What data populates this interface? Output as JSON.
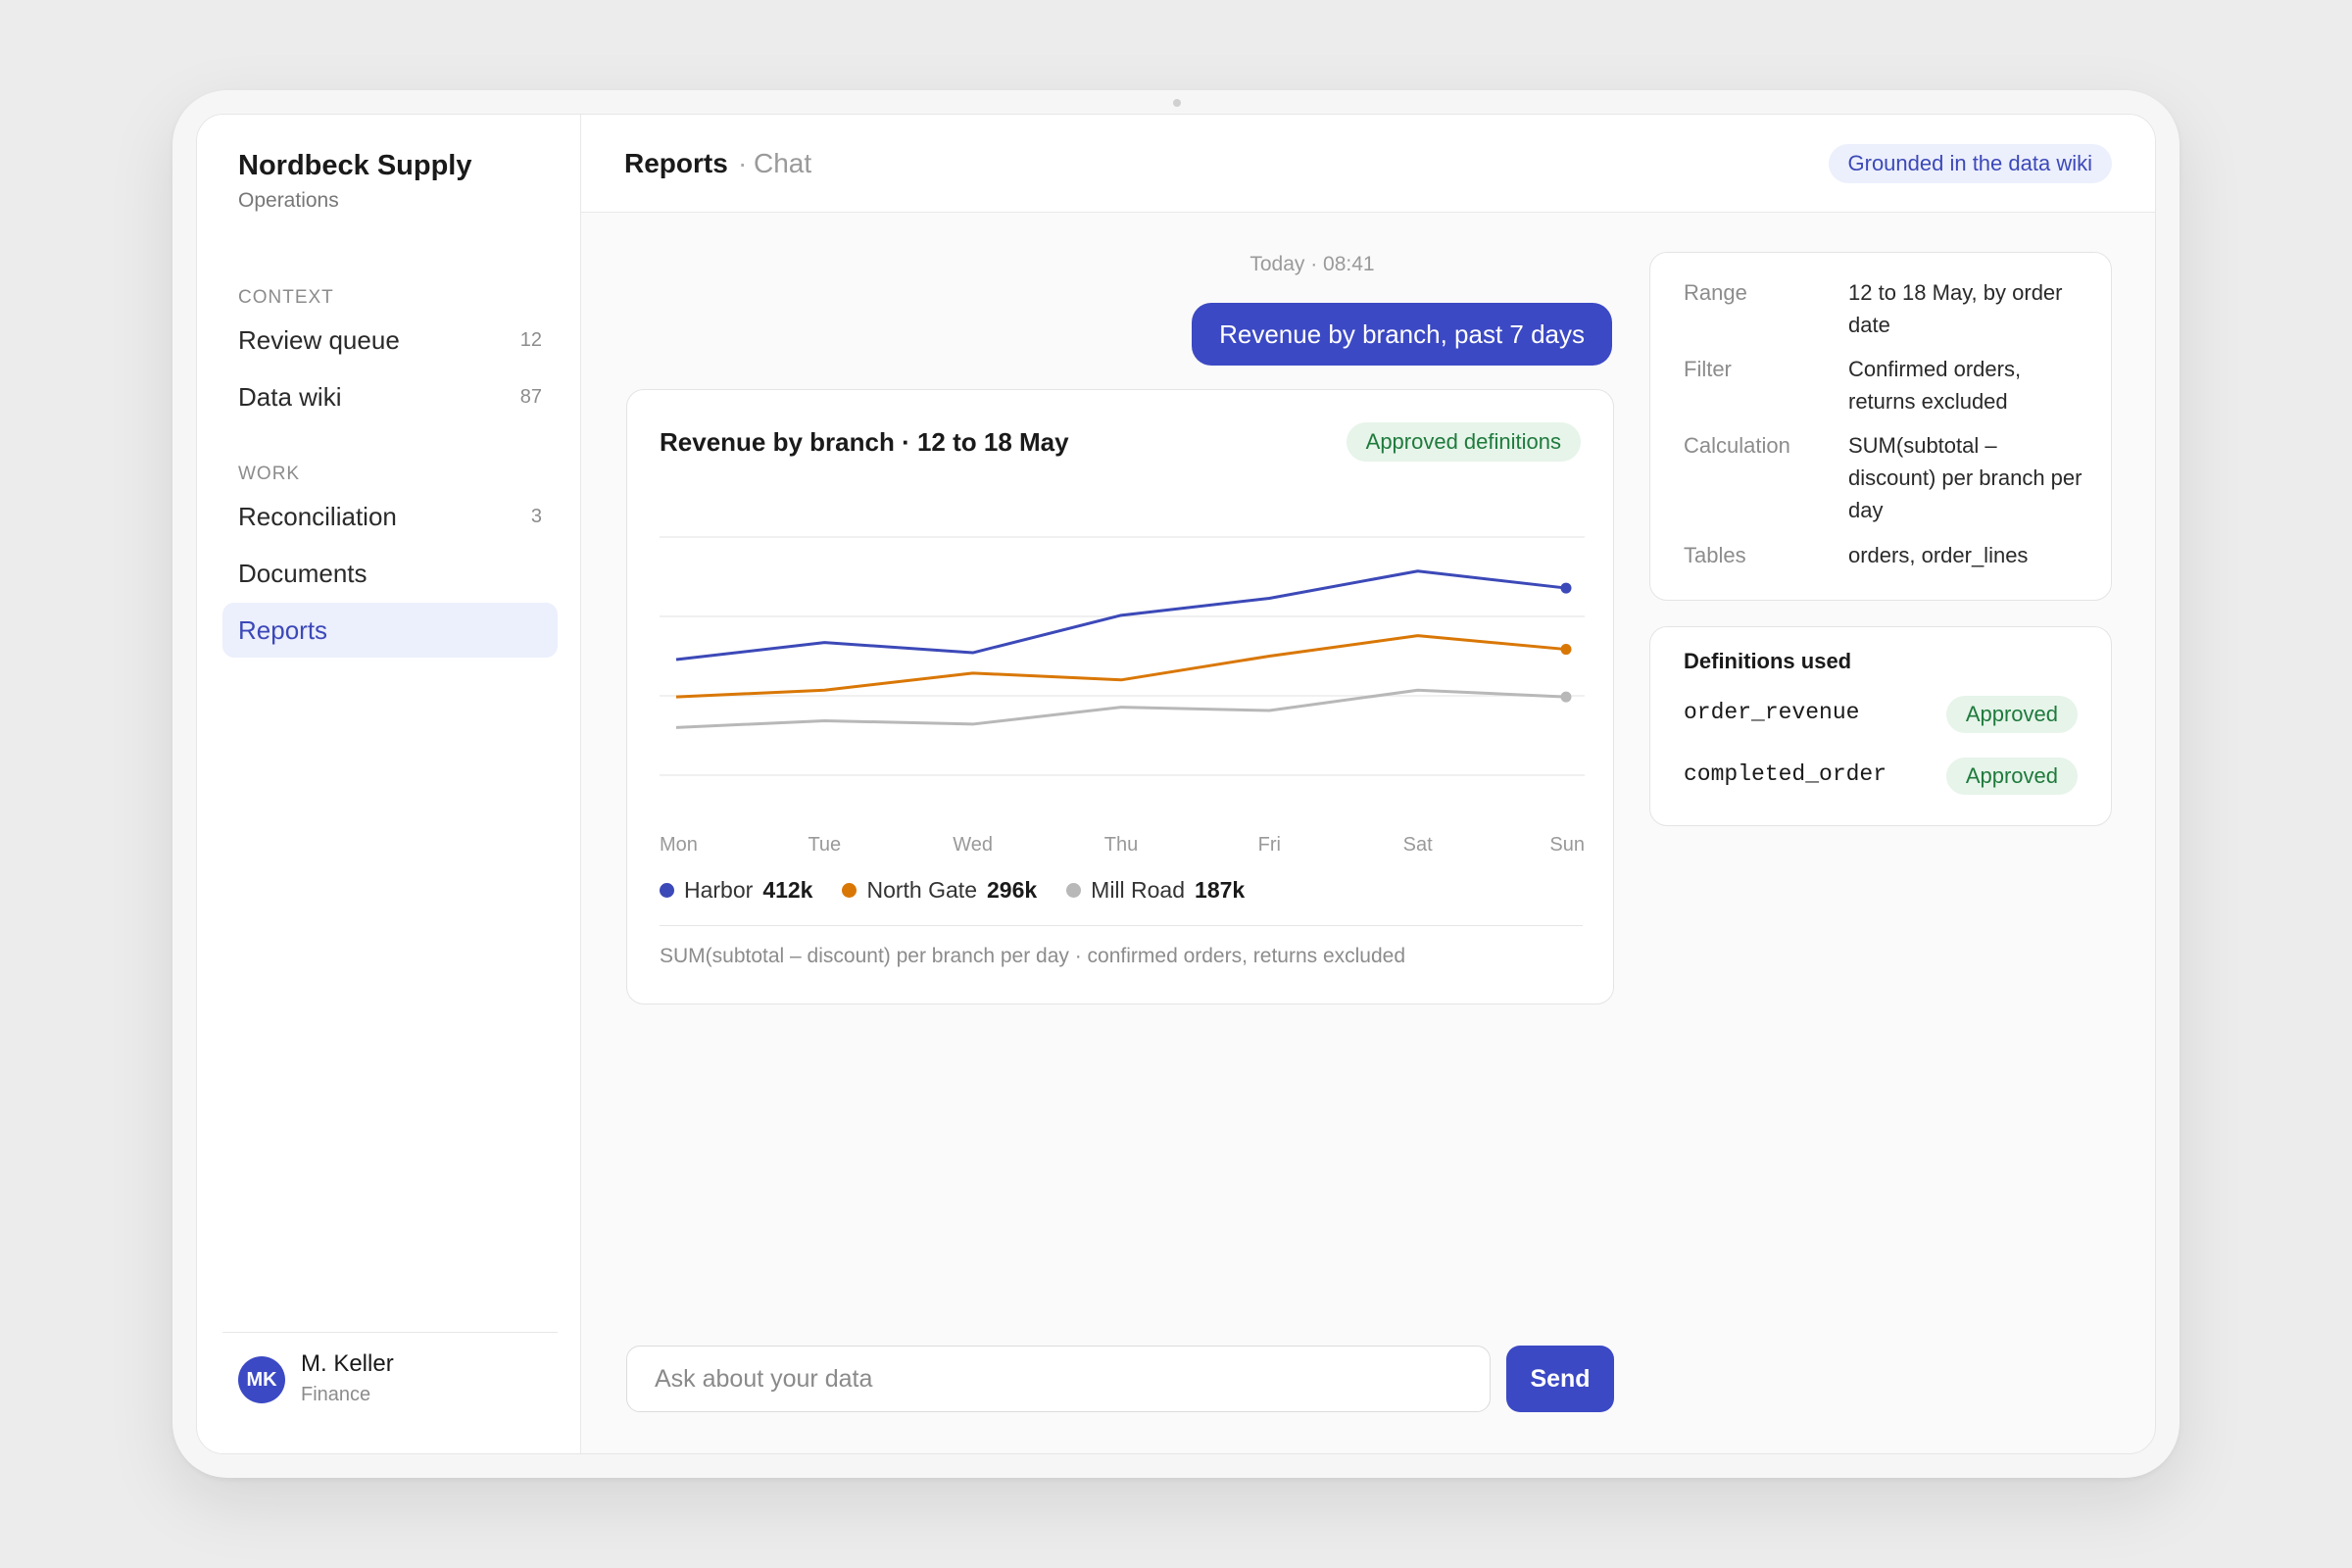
{
  "sidebar": {
    "org_name": "Nordbeck Supply",
    "org_sub": "Operations",
    "sections": [
      {
        "label": "CONTEXT",
        "items": [
          {
            "label": "Review queue",
            "count": "12"
          },
          {
            "label": "Data wiki",
            "count": "87"
          }
        ]
      },
      {
        "label": "WORK",
        "items": [
          {
            "label": "Reconciliation",
            "count": "3"
          },
          {
            "label": "Documents",
            "count": ""
          },
          {
            "label": "Reports",
            "count": "",
            "active": true
          }
        ]
      }
    ],
    "user": {
      "initials": "MK",
      "name": "M. Keller",
      "role": "Finance"
    }
  },
  "header": {
    "title": "Reports",
    "separator": "·",
    "subtitle": "Chat",
    "badge": "Grounded in the data wiki"
  },
  "chat": {
    "timestamp": "Today · 08:41",
    "user_message": "Revenue by branch, past 7 days"
  },
  "chart_card": {
    "title": "Revenue by branch · 12 to 18 May",
    "badge": "Approved definitions",
    "footnote": "SUM(subtotal – discount) per branch per day · confirmed orders, returns excluded"
  },
  "chart_data": {
    "type": "line",
    "categories": [
      "Mon",
      "Tue",
      "Wed",
      "Thu",
      "Fri",
      "Sat",
      "Sun"
    ],
    "series": [
      {
        "name": "Harbor",
        "total": "412k",
        "color": "#3c49b8",
        "values": [
          54,
          59,
          56,
          67,
          72,
          80,
          75
        ]
      },
      {
        "name": "North Gate",
        "total": "296k",
        "color": "#d97706",
        "values": [
          43,
          45,
          50,
          48,
          55,
          61,
          57
        ]
      },
      {
        "name": "Mill Road",
        "total": "187k",
        "color": "#b8b8b8",
        "values": [
          34,
          36,
          35,
          40,
          39,
          45,
          43
        ]
      }
    ],
    "ylim": [
      0,
      100
    ],
    "grid": true,
    "legend": "bottom-left"
  },
  "info": {
    "rows": [
      {
        "label": "Range",
        "value": "12 to 18 May, by order date"
      },
      {
        "label": "Filter",
        "value": "Confirmed orders, returns excluded"
      },
      {
        "label": "Calculation",
        "value": "SUM(subtotal – discount) per branch per day"
      },
      {
        "label": "Tables",
        "value": "orders, order_lines"
      }
    ]
  },
  "definitions": {
    "title": "Definitions used",
    "items": [
      {
        "name": "order_revenue",
        "status": "Approved"
      },
      {
        "name": "completed_order",
        "status": "Approved"
      }
    ]
  },
  "composer": {
    "placeholder": "Ask about your data",
    "send_label": "Send"
  }
}
